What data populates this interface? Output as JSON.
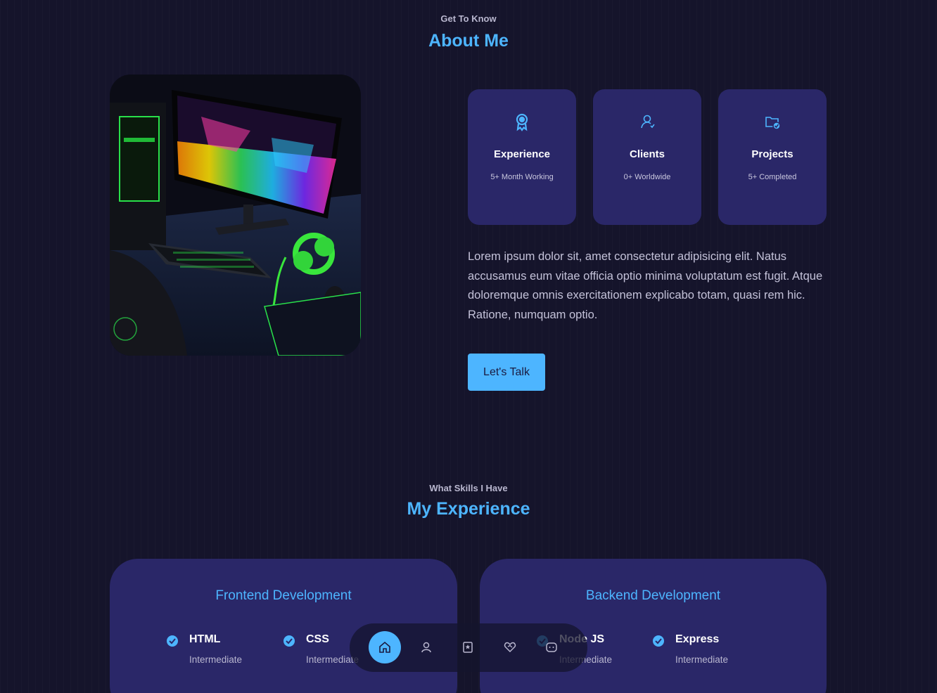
{
  "about": {
    "subtitle": "Get To Know",
    "title": "About Me",
    "image_alt": "Gaming desk setup",
    "cards": [
      {
        "icon": "award-icon",
        "title": "Experience",
        "text": "5+ Month Working"
      },
      {
        "icon": "users-icon",
        "title": "Clients",
        "text": "0+ Worldwide"
      },
      {
        "icon": "folder-check-icon",
        "title": "Projects",
        "text": "5+ Completed"
      }
    ],
    "paragraph": "Lorem ipsum dolor sit, amet consectetur adipisicing elit. Natus accusamus eum vitae officia optio minima voluptatum est fugit. Atque doloremque omnis exercitationem explicabo totam, quasi rem hic. Ratione, numquam optio.",
    "button_label": "Let's Talk"
  },
  "experience": {
    "subtitle": "What Skills I Have",
    "title": "My Experience",
    "frontend": {
      "title": "Frontend Development",
      "skills": [
        {
          "name": "HTML",
          "level": "Intermediate"
        },
        {
          "name": "CSS",
          "level": "Intermediate"
        }
      ]
    },
    "backend": {
      "title": "Backend Development",
      "skills": [
        {
          "name": "Node JS",
          "level": "Intermediate"
        },
        {
          "name": "Express",
          "level": "Intermediate"
        }
      ]
    }
  },
  "nav": {
    "items": [
      "home-icon",
      "user-icon",
      "book-icon",
      "heart-handshake-icon",
      "message-icon"
    ],
    "active": "home-icon"
  },
  "colors": {
    "accent": "#4db5ff",
    "card_bg": "#2a2768",
    "page_bg": "#15142b"
  }
}
